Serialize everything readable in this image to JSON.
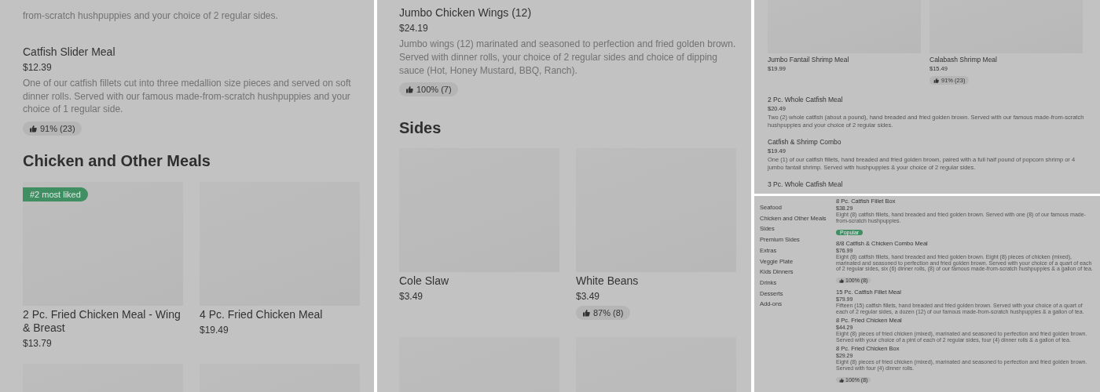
{
  "panels": [
    {
      "kind": "full",
      "blocks": [
        {
          "kind": "item",
          "description": "from-scratch hushpuppies and your choice of 2 regular sides."
        },
        {
          "kind": "item",
          "title": "Catfish Slider Meal",
          "price": "$12.39",
          "description": "One of our catfish fillets cut into three medallion size pieces and served on soft dinner rolls. Served with our famous made-from-scratch hushpuppies and your choice of 1 regular side.",
          "rating": "91% (23)"
        },
        {
          "kind": "heading",
          "text": "Chicken and Other Meals"
        },
        {
          "kind": "cards",
          "cards": [
            {
              "kind": "dish",
              "badge": "#2 most liked",
              "title": "2 Pc. Fried Chicken Meal - Wing & Breast",
              "price": "$13.79"
            },
            {
              "kind": "dish",
              "title": "4 Pc. Fried Chicken Meal",
              "price": "$19.49"
            },
            {
              "kind": "image-only"
            },
            {
              "kind": "image-only"
            }
          ]
        }
      ]
    },
    {
      "kind": "full",
      "blocks": [
        {
          "kind": "item",
          "title": "Jumbo Chicken Wings (12)",
          "price": "$24.19",
          "description": "Jumbo wings (12) marinated and seasoned to perfection and fried golden brown. Served with dinner rolls, your choice of 2 regular sides and choice of dipping sauce (Hot, Honey Mustard, BBQ, Ranch).",
          "rating": "100% (7)"
        },
        {
          "kind": "heading",
          "text": "Sides"
        },
        {
          "kind": "cards",
          "cards": [
            {
              "kind": "dish",
              "title": "Cole Slaw",
              "price": "$3.49"
            },
            {
              "kind": "dish",
              "title": "White Beans",
              "price": "$3.49",
              "rating": "87% (8)"
            },
            {
              "kind": "image-only"
            },
            {
              "kind": "image-only"
            }
          ]
        }
      ]
    },
    {
      "kind": "mini",
      "blocks": [
        {
          "kind": "cards",
          "cards": [
            {
              "kind": "dish",
              "title": "Jumbo Fantail Shrimp Meal",
              "price": "$19.99"
            },
            {
              "kind": "dish",
              "title": "Calabash Shrimp Meal",
              "price": "$15.49",
              "rating": "91% (23)"
            }
          ]
        },
        {
          "kind": "item",
          "title": "2 Pc. Whole Catfish Meal",
          "price": "$20.49",
          "description": "Two (2) whole catfish (about a pound), hand breaded and fried golden brown. Served with our famous made-from-scratch hushpuppies and your choice of 2 regular sides."
        },
        {
          "kind": "item",
          "title": "Catfish & Shrimp Combo",
          "price": "$19.49",
          "description": "One (1) of our catfish fillets, hand breaded and fried golden brown, paired with a full half pound of popcorn shrimp or 4 jumbo fantail shrimp. Served with hushpuppies & your choice of 2 regular sides."
        },
        {
          "kind": "item",
          "title": "3 Pc. Whole Catfish Meal"
        }
      ]
    },
    {
      "kind": "mini-nav",
      "nav": [
        "Seafood",
        "Chicken and Other Meals",
        "Sides",
        "Premium Sides",
        "Extras",
        "Veggie Plate",
        "Kids Dinners",
        "Drinks",
        "Desserts",
        "Add-ons"
      ],
      "blocks": [
        {
          "kind": "item",
          "title": "8 Pc. Catfish Fillet Box",
          "price": "$38.29",
          "description": "Eight (8) catfish fillets, hand breaded and fried golden brown. Served with one (8) of our famous made-from-scratch hushpuppies.",
          "tag": "Popular"
        },
        {
          "kind": "item",
          "title": "8/8 Catfish & Chicken Combo Meal",
          "price": "$76.99",
          "description": "Eight (8) catfish fillets, hand breaded and fried golden brown. Eight (8) pieces of chicken (mixed), marinated and seasoned to perfection and fried golden brown. Served with your choice of a quart of each of 2 regular sides, six (6) dinner rolls, (8) of our famous made-from-scratch hushpuppies & a gallon of tea.",
          "rating": "100% (8)"
        },
        {
          "kind": "item",
          "title": "15 Pc. Catfish Fillet Meal",
          "price": "$79.99",
          "description": "Fifteen (15) catfish fillets, hand breaded and fried golden brown. Served with your choice of a quart of each of 2 regular sides, a dozen (12) of our famous made-from-scratch hushpuppies & a gallon of tea."
        },
        {
          "kind": "item",
          "title": "8 Pc. Fried Chicken Meal",
          "price": "$44.29",
          "description": "Eight (8) pieces of fried chicken (mixed), marinated and seasoned to perfection and fried golden brown. Served with your choice of a pint of each of 2 regular sides, four (4) dinner rolls & a gallon of tea."
        },
        {
          "kind": "item",
          "title": "8 Pc. Fried Chicken Box",
          "price": "$29.29",
          "description": "Eight (8) pieces of fried chicken (mixed), marinated and seasoned to perfection and fried golden brown. Served with four (4) dinner rolls.",
          "rating": "100% (8)"
        }
      ]
    }
  ]
}
